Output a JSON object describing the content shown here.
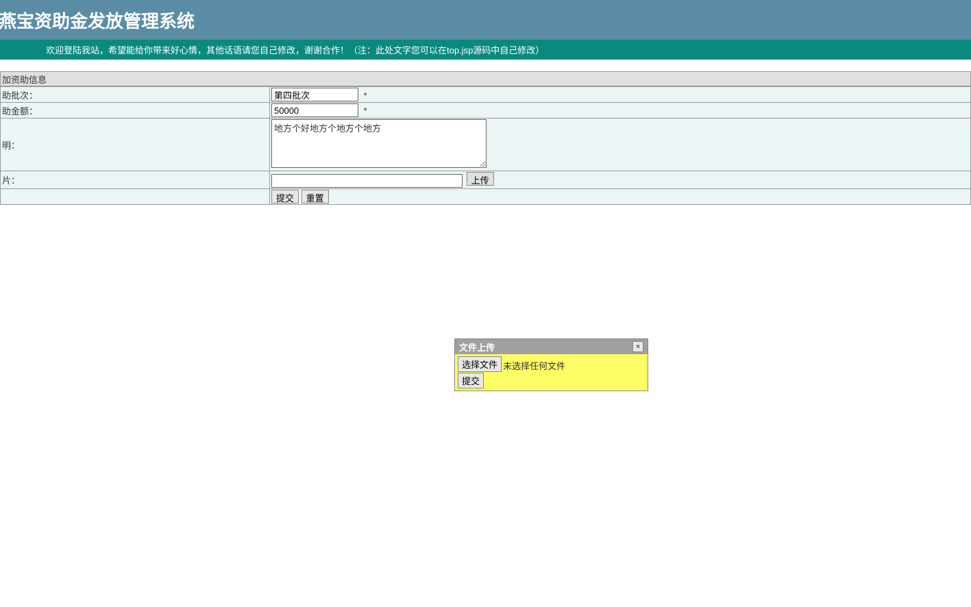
{
  "header": {
    "title": "燕宝资助金发放管理系统",
    "welcome": "欢迎登陆我站，希望能给你带来好心情，其他话语请您自己修改，谢谢合作！（注：此处文字您可以在top.jsp源码中自己修改）"
  },
  "form": {
    "section_title": "加资助信息",
    "fields": {
      "batch": {
        "label": "助批次：",
        "value": "第四批次",
        "required": "*"
      },
      "amount": {
        "label": "助金额：",
        "value": "50000",
        "required": "*"
      },
      "detail": {
        "label": "明：",
        "value": "地方个好地方个地方个地方"
      },
      "file": {
        "label": "片：",
        "value": "",
        "upload_btn": "上传"
      }
    },
    "buttons": {
      "submit": "提交",
      "reset": "重置"
    }
  },
  "modal": {
    "title": "文件上传",
    "choose_file": "选择文件",
    "no_file": "未选择任何文件",
    "submit": "提交",
    "close": "×"
  }
}
